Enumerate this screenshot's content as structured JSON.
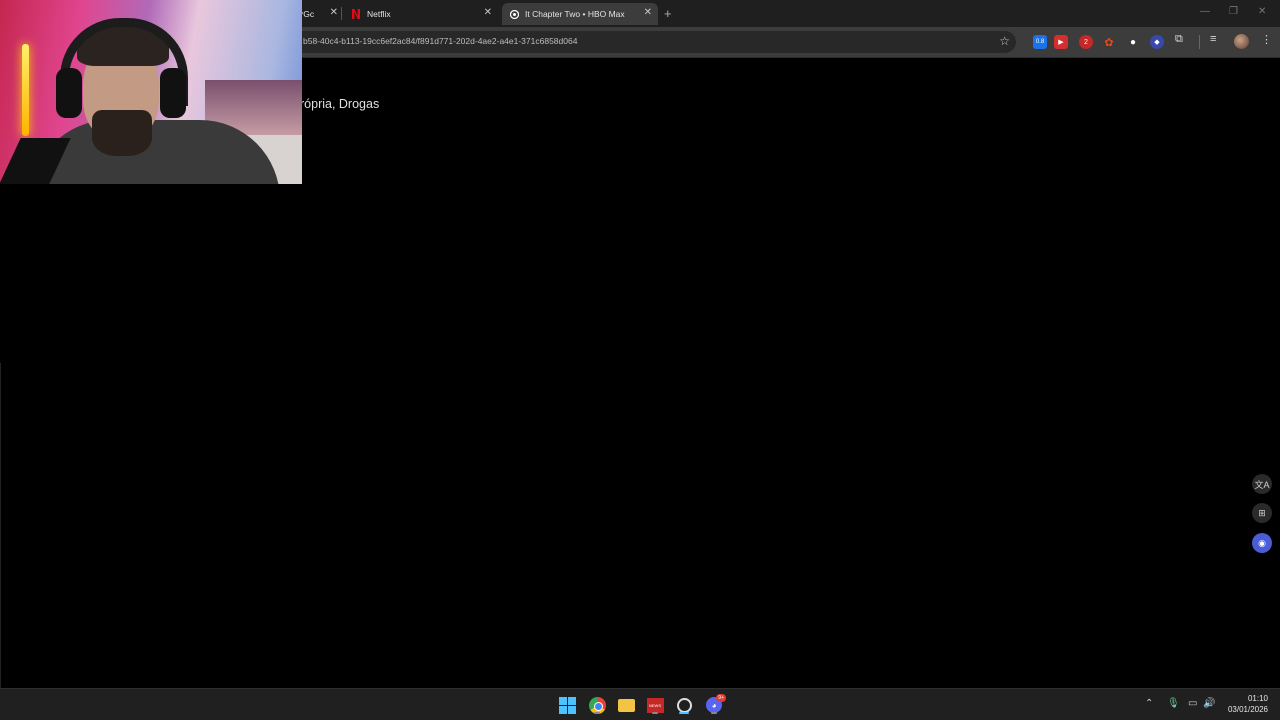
{
  "browser": {
    "tabs": [
      {
        "label": "*Gc",
        "favicon": "generic-icon"
      },
      {
        "label": "Netflix",
        "favicon": "netflix-icon"
      },
      {
        "label": "It Chapter Two • HBO Max",
        "favicon": "hbo-icon",
        "active": true
      }
    ],
    "url": "b58-40c4-b113-19cc6ef2ac84/f891d771-202d-4ae2-a4e1-371c6858d064",
    "extensions": [
      {
        "name": "speed-extension-icon",
        "text": "0.8",
        "color": "#1a73e8"
      },
      {
        "name": "youtube-extension-icon",
        "text": "",
        "color": "#d32f2f"
      },
      {
        "name": "badge-extension-icon",
        "text": "2",
        "color": "#c62828"
      },
      {
        "name": "maple-extension-icon",
        "text": "",
        "color": "#e64a19"
      },
      {
        "name": "chat-extension-icon",
        "text": "",
        "color": "#555555"
      },
      {
        "name": "vpn-extension-icon",
        "text": "",
        "color": "#3949ab"
      }
    ]
  },
  "page": {
    "tags_text": "rópria, Drogas"
  },
  "taskbar": {
    "time": "01:10",
    "date": "03/01/2026",
    "chrome_badge": "",
    "news_label": "NEWS",
    "discord_badge": "9+"
  },
  "colors": {
    "page_bg": "#000000",
    "tabstrip_bg": "#1f1f1f",
    "toolbar_bg": "#3c3c3c",
    "taskbar_bg": "#202020"
  }
}
